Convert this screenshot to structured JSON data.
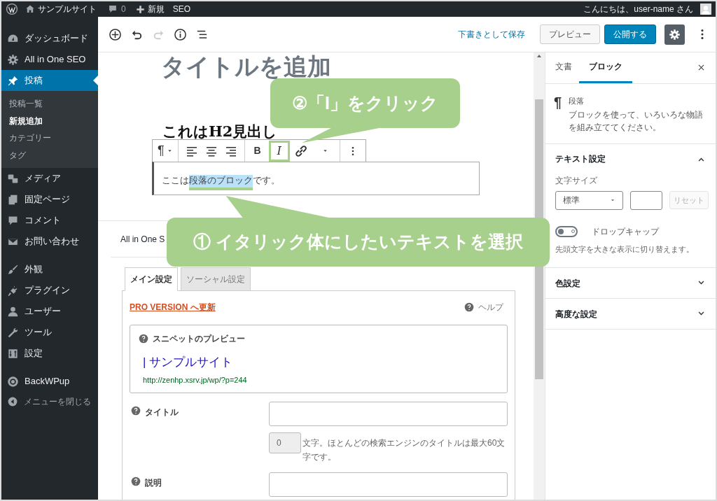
{
  "admin_bar": {
    "site_name": "サンプルサイト",
    "comments": "0",
    "new_label": "新規",
    "seo": "SEO",
    "greeting": "こんにちは、user-name さん"
  },
  "sidebar": {
    "sections": [
      {
        "items": [
          {
            "label": "ダッシュボード",
            "selected": false
          },
          {
            "label": "All in One SEO",
            "selected": false
          },
          {
            "label": "投稿",
            "selected": true,
            "children": [
              {
                "label": "投稿一覧",
                "selected": false
              },
              {
                "label": "新規追加",
                "selected": true
              },
              {
                "label": "カテゴリー",
                "selected": false
              },
              {
                "label": "タグ",
                "selected": false
              }
            ]
          },
          {
            "label": "メディア",
            "selected": false
          },
          {
            "label": "固定ページ",
            "selected": false
          },
          {
            "label": "コメント",
            "selected": false
          },
          {
            "label": "お問い合わせ",
            "selected": false
          }
        ]
      },
      {
        "items": [
          {
            "label": "外観",
            "selected": false
          },
          {
            "label": "プラグイン",
            "selected": false
          },
          {
            "label": "ユーザー",
            "selected": false
          },
          {
            "label": "ツール",
            "selected": false
          },
          {
            "label": "設定",
            "selected": false
          }
        ]
      },
      {
        "items": [
          {
            "label": "BackWPup",
            "selected": false
          }
        ]
      }
    ],
    "collapse_button": "メニューを閉じる"
  },
  "editor_header": {
    "undo": {
      "disabled": false
    },
    "redo": {
      "disabled": true
    },
    "save_draft": "下書きとして保存",
    "preview": "プレビュー",
    "publish": "公開する"
  },
  "post": {
    "title_placeholder": "タイトルを追加",
    "heading": "これはH2見出し",
    "block_toolbar": {
      "type_glyph": "¶",
      "bold": "B",
      "italic": "I"
    },
    "paragraph": [
      {
        "text": "ここは",
        "selected": false
      },
      {
        "text": "段落のブロック",
        "selected": true
      },
      {
        "text": "です。",
        "selected": false
      }
    ]
  },
  "seo_box": {
    "title": "All in One S",
    "tabs": [
      {
        "label": "メイン設定",
        "selected": true
      },
      {
        "label": "ソーシャル設定",
        "selected": false
      }
    ],
    "upgrade_link": "PRO VERSION へ更新",
    "help": "ヘルプ",
    "snippet": {
      "heading": "スニペットのプレビュー",
      "title": "| サンプルサイト",
      "url": "http://zenhp.xsrv.jp/wp/?p=244"
    },
    "fields": [
      {
        "label": "タイトル",
        "counter": "0",
        "note": "文字。ほとんどの検索エンジンのタイトルは最大60文字です。"
      },
      {
        "label": "説明"
      }
    ]
  },
  "settings_panel": {
    "tabs": [
      {
        "label": "文書",
        "selected": false
      },
      {
        "label": "ブロック",
        "selected": true
      }
    ],
    "block": {
      "glyph": "¶",
      "name": "段落",
      "description": "ブロックを使って、いろいろな物語を組み立ててください。"
    },
    "sections": [
      {
        "title": "テキスト設定",
        "expanded": true,
        "font_size_label": "文字サイズ",
        "font_size": "標準",
        "reset": "リセット",
        "reset_disabled": true,
        "drop_cap": {
          "label": "ドロップキャップ",
          "on": false
        },
        "help": "先頭文字を大きな表示に切り替えます。"
      },
      {
        "title": "色設定",
        "expanded": false
      },
      {
        "title": "高度な設定",
        "expanded": false
      }
    ]
  },
  "callouts": [
    {
      "text": "②「I」をクリック"
    },
    {
      "text": "① イタリック体にしたいテキストを選択"
    }
  ]
}
